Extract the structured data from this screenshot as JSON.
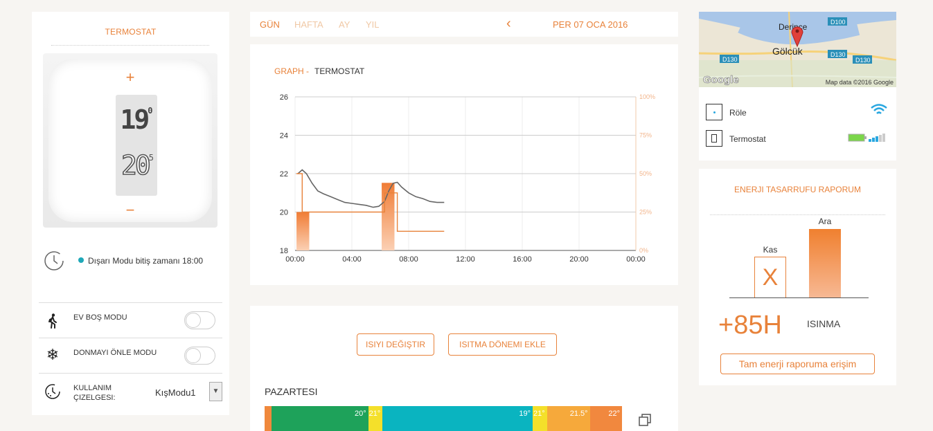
{
  "thermostat": {
    "title": "TERMOSTAT",
    "plus": "+",
    "minus": "−",
    "current_temp": "19",
    "current_temp_decimal": "0",
    "set_temp": "20",
    "set_temp_decimal": "5",
    "mode_text": "Dışarı Modu bitiş zamanı 18:00"
  },
  "settings": {
    "away_label": "EV BOŞ MODU",
    "frost_label": "DONMAYI ÖNLE MODU",
    "schedule_label_1": "KULLANIM",
    "schedule_label_2": "ÇIZELGESI:",
    "schedule_value": "KışModu1"
  },
  "nav": {
    "tabs": [
      "GÜN",
      "HAFTA",
      "AY",
      "YIL"
    ],
    "active_tab": "GÜN",
    "date": "PER 07 OCA 2016"
  },
  "graph": {
    "title_prefix": "GRAPH -",
    "title": "TERMOSTAT"
  },
  "chart_data": {
    "type": "line",
    "title": "GRAPH - TERMOSTAT",
    "x_ticks": [
      "00:00",
      "04:00",
      "08:00",
      "12:00",
      "16:00",
      "20:00",
      "00:00"
    ],
    "y_ticks": [
      18,
      20,
      22,
      24,
      26
    ],
    "y2_ticks": [
      "0%",
      "25%",
      "50%",
      "75%",
      "100%"
    ],
    "ylim": [
      18,
      26
    ],
    "y2lim": [
      0,
      100
    ],
    "grid": true,
    "series": [
      {
        "kind": "line",
        "color": "#666666",
        "points": [
          [
            0.2,
            22.0
          ],
          [
            0.5,
            22.2
          ],
          [
            0.8,
            22.0
          ],
          [
            1.2,
            21.5
          ],
          [
            1.6,
            21.1
          ],
          [
            2.0,
            20.95
          ],
          [
            2.5,
            20.8
          ],
          [
            3.0,
            20.65
          ],
          [
            3.5,
            20.5
          ],
          [
            4.0,
            20.45
          ],
          [
            4.5,
            20.4
          ],
          [
            5.0,
            20.35
          ],
          [
            5.5,
            20.25
          ],
          [
            5.9,
            20.3
          ],
          [
            6.3,
            20.55
          ],
          [
            6.6,
            21.1
          ],
          [
            6.9,
            21.5
          ],
          [
            7.2,
            21.55
          ],
          [
            7.5,
            21.3
          ],
          [
            8.0,
            21.0
          ],
          [
            8.5,
            20.8
          ],
          [
            9.0,
            20.7
          ],
          [
            9.5,
            20.55
          ],
          [
            10.0,
            20.5
          ],
          [
            10.5,
            20.5
          ]
        ]
      },
      {
        "kind": "step",
        "color": "#e8823a",
        "points": [
          [
            0.1,
            22.0
          ],
          [
            0.5,
            22.0
          ],
          [
            0.5,
            20.0
          ],
          [
            6.3,
            20.0
          ],
          [
            6.3,
            21.0
          ],
          [
            7.2,
            21.0
          ],
          [
            7.2,
            19.0
          ],
          [
            10.5,
            19.0
          ]
        ]
      },
      {
        "kind": "bars",
        "color": "#f08a4b",
        "axis": "y2",
        "bars": [
          {
            "start": 0.1,
            "end": 1.0,
            "value": 25
          },
          {
            "start": 6.1,
            "end": 7.0,
            "value": 44
          }
        ]
      }
    ]
  },
  "schedule": {
    "btn_change": "ISIYI DEĞIŞTIR",
    "btn_add": "ISITMA DÖNEMI EKLE",
    "day": "PAZARTESI",
    "segments": [
      {
        "label": "",
        "color": "#f0883c",
        "start": 0,
        "end": 2
      },
      {
        "label": "20°",
        "color": "#1ea25a",
        "start": 2,
        "end": 29
      },
      {
        "label": "21°",
        "color": "#f4e02a",
        "start": 29,
        "end": 33
      },
      {
        "label": "19°",
        "color": "#0ab4c0",
        "start": 33,
        "end": 75
      },
      {
        "label": "21°",
        "color": "#f4e02a",
        "start": 75,
        "end": 79
      },
      {
        "label": "21.5°",
        "color": "#f6a93b",
        "start": 79,
        "end": 91
      },
      {
        "label": "22°",
        "color": "#f1883e",
        "start": 91,
        "end": 100
      }
    ]
  },
  "map": {
    "labels": [
      "Derince",
      "Gölcük",
      "D100",
      "D130",
      "D130",
      "D130"
    ],
    "credit": "Map data ©2016 Google",
    "logo": "Google"
  },
  "devices": [
    {
      "name": "Röle",
      "icon": "wifi-icon"
    },
    {
      "name": "Termostat",
      "icon": "battery-icon"
    }
  ],
  "energy": {
    "title": "ENERJI TASARRUFU RAPORUM",
    "bar_kas_label": "Kas",
    "bar_kas_value_mark": "X",
    "bar_ara_label": "Ara",
    "big_value": "+85H",
    "unit": "ISINMA",
    "link": "Tam enerji raporuma erişim"
  },
  "colors": {
    "accent": "#e8823a",
    "background": "#f7f5f2",
    "wifi": "#29a7e0",
    "battery": "#7bd64a"
  }
}
